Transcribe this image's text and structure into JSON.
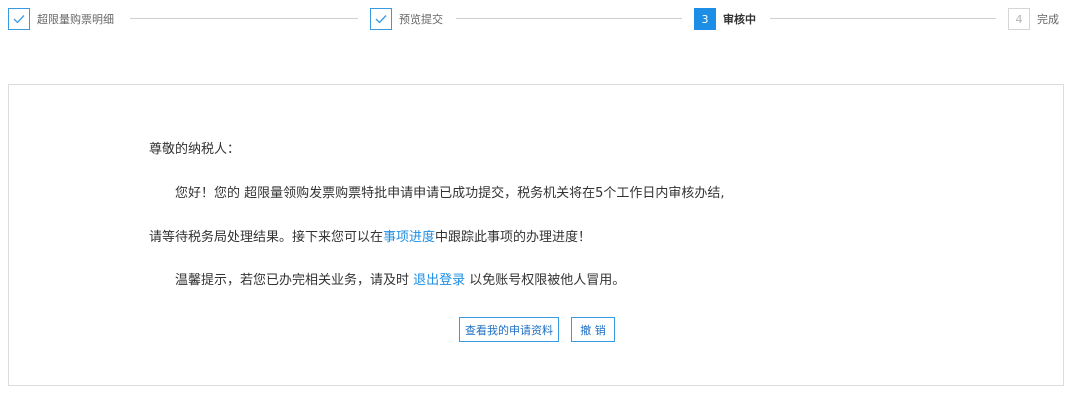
{
  "stepper": {
    "steps": [
      {
        "label": "超限量购票明细",
        "status": "done",
        "icon": "check-icon"
      },
      {
        "label": "预览提交",
        "status": "done",
        "icon": "check-icon"
      },
      {
        "label": "审核中",
        "status": "active",
        "number": "3"
      },
      {
        "label": "完成",
        "status": "pending",
        "number": "4"
      }
    ]
  },
  "notice": {
    "greeting": "尊敬的纳税人：",
    "line1": "您好！您的 超限量领购发票购票特批申请申请已成功提交，税务机关将在5个工作日内审核办结,",
    "line2_prefix": "请等待税务局处理结果。接下来您可以在",
    "line2_link": "事项进度",
    "line2_suffix": "中跟踪此事项的办理进度！",
    "line3_prefix": "温馨提示，若您已办完相关业务，请及时 ",
    "line3_link": "退出登录",
    "line3_suffix": " 以免账号权限被他人冒用。"
  },
  "actions": {
    "view_label": "查看我的申请资料",
    "revoke_label": "撤 销"
  },
  "colors": {
    "accent": "#1d8ee6",
    "border": "#dcdcdc",
    "line": "#cfcfcf"
  }
}
